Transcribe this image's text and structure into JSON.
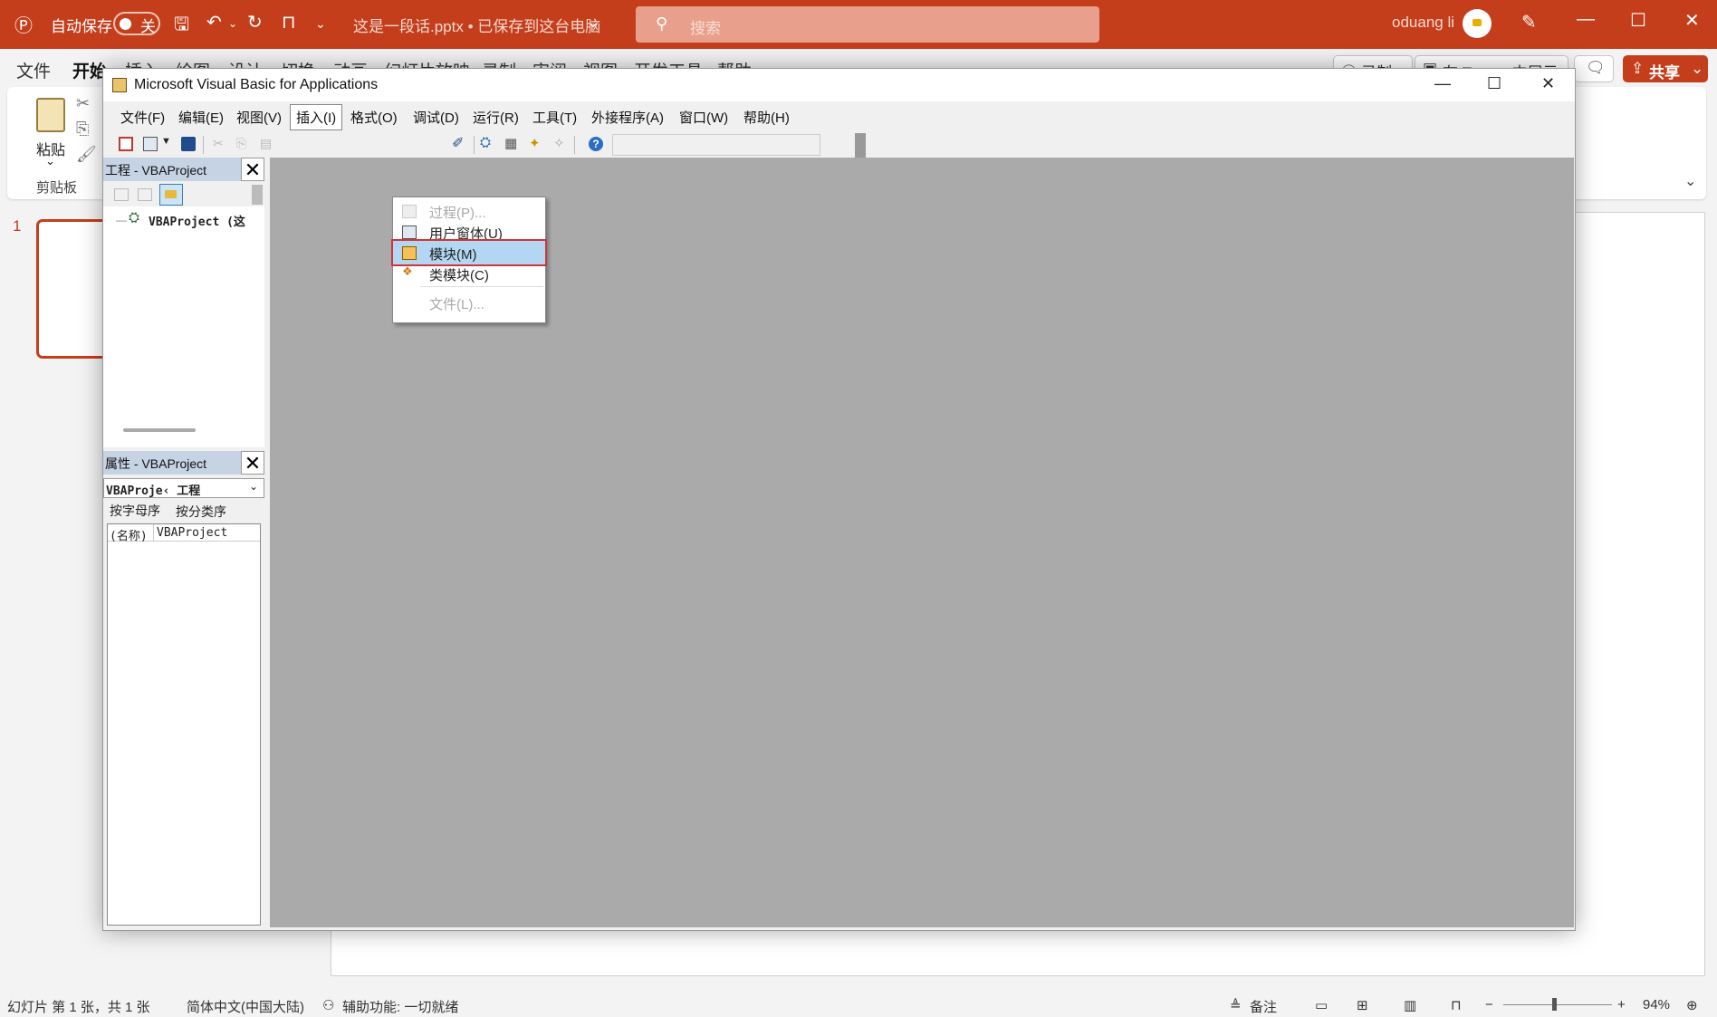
{
  "ppt": {
    "autosave_label": "自动保存",
    "autosave_state": "关",
    "doc_title": "这是一段话.pptx • 已保存到这台电脑",
    "search_placeholder": "搜索",
    "user_name": "oduang li",
    "tabs": [
      "文件",
      "开始",
      "插入",
      "绘图",
      "设计",
      "切换",
      "动画",
      "幻灯片放映",
      "录制",
      "审阅",
      "视图",
      "开发工具",
      "帮助"
    ],
    "record_label": "录制",
    "teams_label": "在 Teams 中展示",
    "share_label": "共享",
    "paste_label": "粘贴",
    "clipboard_label": "剪贴板",
    "slide_number": "1"
  },
  "status": {
    "slide_info": "幻灯片 第 1 张，共 1 张",
    "language": "简体中文(中国大陆)",
    "accessibility": "辅助功能: 一切就绪",
    "notes": "备注",
    "zoom": "94%"
  },
  "vba": {
    "title": "Microsoft Visual Basic for Applications",
    "menu": [
      "文件(F)",
      "编辑(E)",
      "视图(V)",
      "插入(I)",
      "格式(O)",
      "调试(D)",
      "运行(R)",
      "工具(T)",
      "外接程序(A)",
      "窗口(W)",
      "帮助(H)"
    ],
    "project_pane_title": "工程 - VBAProject",
    "project_tree_item": "VBAProject (这",
    "props_pane_title": "属性 - VBAProject",
    "props_combo": "VBAProje‹ 工程",
    "props_tab_alpha": "按字母序",
    "props_tab_cat": "按分类序",
    "props_row_name": "(名称)",
    "props_row_value": "VBAProject",
    "insert_menu": [
      {
        "label": "过程(P)...",
        "enabled": false
      },
      {
        "label": "用户窗体(U)",
        "enabled": true
      },
      {
        "label": "模块(M)",
        "enabled": true,
        "highlighted": true
      },
      {
        "label": "类模块(C)",
        "enabled": true
      },
      {
        "label": "文件(L)...",
        "enabled": false
      }
    ]
  },
  "colors": {
    "ppt_accent": "#c43e1c",
    "highlight": "#b3d7f3",
    "highlight_border": "#d13438",
    "code_bg": "#aaaaaa"
  }
}
